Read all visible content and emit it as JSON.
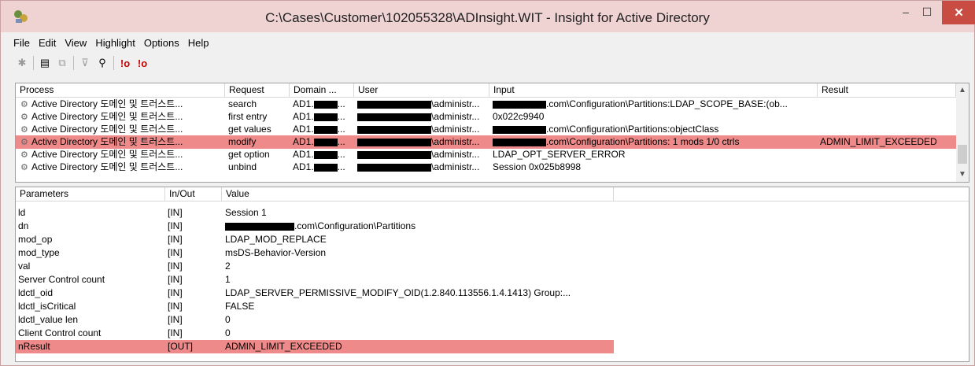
{
  "window": {
    "title": "C:\\Cases\\Customer\\102055328\\ADInsight.WIT - Insight for Active Directory",
    "min_label": "–",
    "max_label": "☐",
    "close_label": "✕"
  },
  "menu": [
    "File",
    "Edit",
    "View",
    "Highlight",
    "Options",
    "Help"
  ],
  "toolbar": {
    "icons": [
      "find-icon",
      "properties-icon",
      "clear-icon",
      "filter-icon",
      "binoculars-icon",
      "highlight-error-icon",
      "highlight-error-2-icon"
    ]
  },
  "events": {
    "columns": [
      "Process",
      "Request",
      "Domain ...",
      "User",
      "Input",
      "Result"
    ],
    "rows": [
      {
        "process": "Active Directory 도메인 및 트러스트...",
        "request": "search",
        "domain": "AD1.",
        "user": "\\administr...",
        "input": ".com\\Configuration\\Partitions:LDAP_SCOPE_BASE:(ob...",
        "result": ""
      },
      {
        "process": "Active Directory 도메인 및 트러스트...",
        "request": "first entry",
        "domain": "AD1.",
        "user": "\\administr...",
        "input": "0x022c9940",
        "result": ""
      },
      {
        "process": "Active Directory 도메인 및 트러스트...",
        "request": "get values",
        "domain": "AD1.",
        "user": "\\administr...",
        "input": ".com\\Configuration\\Partitions:objectClass",
        "result": ""
      },
      {
        "process": "Active Directory 도메인 및 트러스트...",
        "request": "modify",
        "domain": "AD1.",
        "user": "\\administr...",
        "input": ".com\\Configuration\\Partitions: 1 mods 1/0 ctrls",
        "result": "ADMIN_LIMIT_EXCEEDED"
      },
      {
        "process": "Active Directory 도메인 및 트러스트...",
        "request": "get option",
        "domain": "AD1.",
        "user": "\\administr...",
        "input": "LDAP_OPT_SERVER_ERROR",
        "result": ""
      },
      {
        "process": "Active Directory 도메인 및 트러스트...",
        "request": "unbind",
        "domain": "AD1.",
        "user": "\\administr...",
        "input": "Session 0x025b8998",
        "result": ""
      }
    ],
    "highlighted_row": 3
  },
  "details": {
    "columns": [
      "Parameters",
      "In/Out",
      "Value"
    ],
    "rows": [
      {
        "param": "ld",
        "io": "[IN]",
        "value": "Session 1"
      },
      {
        "param": "dn",
        "io": "[IN]",
        "value": ".com\\Configuration\\Partitions"
      },
      {
        "param": "mod_op",
        "io": "[IN]",
        "value": "LDAP_MOD_REPLACE"
      },
      {
        "param": "mod_type",
        "io": "[IN]",
        "value": "msDS-Behavior-Version"
      },
      {
        "param": "val",
        "io": "[IN]",
        "value": "2"
      },
      {
        "param": "Server Control count",
        "io": "[IN]",
        "value": "1"
      },
      {
        "param": "ldctl_oid",
        "io": "[IN]",
        "value": "LDAP_SERVER_PERMISSIVE_MODIFY_OID(1.2.840.113556.1.4.1413) Group:..."
      },
      {
        "param": "ldctl_isCritical",
        "io": "[IN]",
        "value": "FALSE"
      },
      {
        "param": "ldctl_value len",
        "io": "[IN]",
        "value": "0"
      },
      {
        "param": "Client Control count",
        "io": "[IN]",
        "value": "0"
      },
      {
        "param": "nResult",
        "io": "[OUT]",
        "value": "ADMIN_LIMIT_EXCEEDED"
      }
    ],
    "highlighted_row": 10
  },
  "colors": {
    "titlebar": "#efd2d2",
    "highlight": "#ef8a8a",
    "close": "#c94c43"
  }
}
